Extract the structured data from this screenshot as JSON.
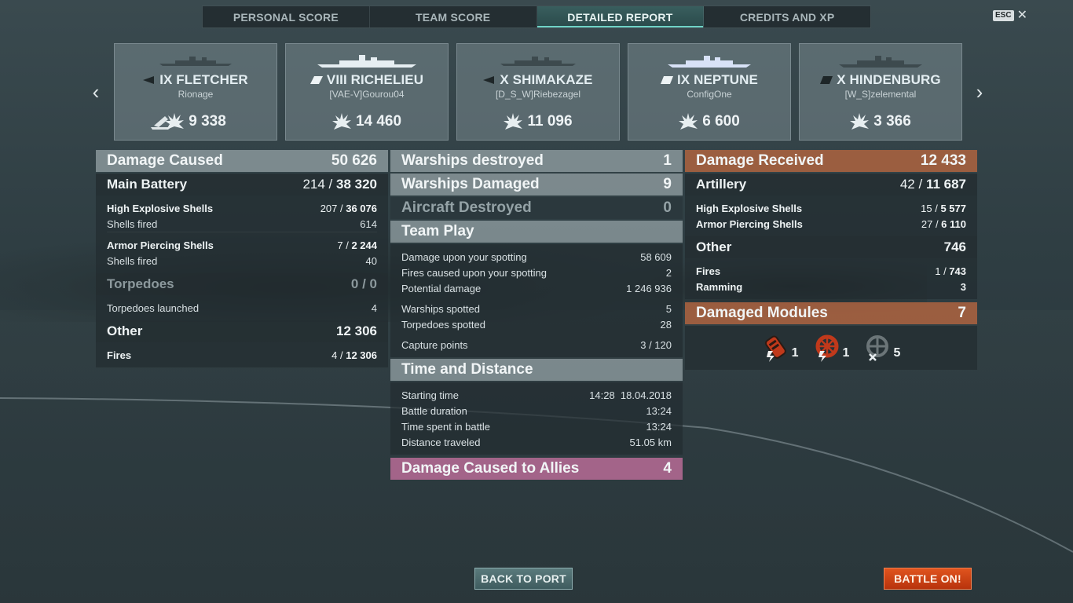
{
  "tabs": [
    {
      "label": "PERSONAL SCORE",
      "active": false
    },
    {
      "label": "TEAM SCORE",
      "active": false
    },
    {
      "label": "DETAILED REPORT",
      "active": true
    },
    {
      "label": "CREDITS AND XP",
      "active": false
    }
  ],
  "esc_label": "ESC",
  "nav": {
    "prev": "‹",
    "next": "›"
  },
  "ships": [
    {
      "name": "IX FLETCHER",
      "player": "Rionage",
      "damage": "9 338",
      "class": "destroyer",
      "sunk": true
    },
    {
      "name": "VIII RICHELIEU",
      "player": "[VAE-V]Gourou04",
      "damage": "14 460",
      "class": "battleship",
      "sunk": false
    },
    {
      "name": "X SHIMAKAZE",
      "player": "[D_S_W]Riebezagel",
      "damage": "11 096",
      "class": "destroyer",
      "sunk": false
    },
    {
      "name": "IX NEPTUNE",
      "player": "ConfigOne",
      "damage": "6 600",
      "class": "cruiser",
      "sunk": false
    },
    {
      "name": "X HINDENBURG",
      "player": "[W_S]zelemental",
      "damage": "3 366",
      "class": "cruiser",
      "sunk": false
    }
  ],
  "left": {
    "damage_caused": {
      "label": "Damage Caused",
      "value": "50 626"
    },
    "main_battery": {
      "label": "Main Battery",
      "hits": "214",
      "sep": " / ",
      "value": "38 320"
    },
    "he": {
      "label": "High Explosive Shells",
      "hits": "207",
      "value": "36 076"
    },
    "he_fired": {
      "label": "Shells fired",
      "value": "614"
    },
    "ap": {
      "label": "Armor Piercing Shells",
      "hits": "7",
      "value": "2 244"
    },
    "ap_fired": {
      "label": "Shells fired",
      "value": "40"
    },
    "torpedoes": {
      "label": "Torpedoes",
      "value": "0 / 0"
    },
    "torp_launched": {
      "label": "Torpedoes launched",
      "value": "4"
    },
    "other": {
      "label": "Other",
      "value": "12 306"
    },
    "fires": {
      "label": "Fires",
      "hits": "4",
      "value": "12 306"
    }
  },
  "mid": {
    "destroyed": {
      "label": "Warships destroyed",
      "value": "1"
    },
    "damaged": {
      "label": "Warships Damaged",
      "value": "9"
    },
    "aircraft": {
      "label": "Aircraft Destroyed",
      "value": "0"
    },
    "team_play": {
      "label": "Team Play"
    },
    "spotting_dmg": {
      "label": "Damage upon your spotting",
      "value": "58 609"
    },
    "spotting_fires": {
      "label": "Fires caused upon your spotting",
      "value": "2"
    },
    "potential": {
      "label": "Potential damage",
      "value": "1 246 936"
    },
    "ships_spotted": {
      "label": "Warships spotted",
      "value": "5"
    },
    "torps_spotted": {
      "label": "Torpedoes spotted",
      "value": "28"
    },
    "capture": {
      "label": "Capture points",
      "value": "3 / 120"
    },
    "time_distance": {
      "label": "Time and Distance"
    },
    "start": {
      "label": "Starting time",
      "value": "14:28  18.04.2018"
    },
    "duration": {
      "label": "Battle duration",
      "value": "13:24"
    },
    "time_spent": {
      "label": "Time spent in battle",
      "value": "13:24"
    },
    "distance": {
      "label": "Distance traveled",
      "value": "51.05 km"
    },
    "allies": {
      "label": "Damage Caused to Allies",
      "value": "4"
    }
  },
  "right": {
    "received": {
      "label": "Damage Received",
      "value": "12 433"
    },
    "artillery": {
      "label": "Artillery",
      "hits": "42",
      "value": "11 687"
    },
    "he": {
      "label": "High Explosive Shells",
      "hits": "15",
      "value": "5 577"
    },
    "ap": {
      "label": "Armor Piercing Shells",
      "hits": "27",
      "value": "6 110"
    },
    "other": {
      "label": "Other",
      "value": "746"
    },
    "fires": {
      "label": "Fires",
      "hits": "1",
      "value": "743"
    },
    "ramming": {
      "label": "Ramming",
      "value": "3"
    },
    "modules": {
      "label": "Damaged Modules",
      "value": "7"
    },
    "module_counts": [
      {
        "icon": "engine-damaged-icon",
        "count": "1"
      },
      {
        "icon": "steering-damaged-icon",
        "count": "1"
      },
      {
        "icon": "turret-destroyed-icon",
        "count": "5"
      }
    ]
  },
  "buttons": {
    "back": "BACK TO PORT",
    "battle": "BATTLE ON!"
  },
  "colors": {
    "accent": "#6fd3c7",
    "received": "#aa6240",
    "allies": "#b86c96",
    "battle": "#d8481a"
  }
}
